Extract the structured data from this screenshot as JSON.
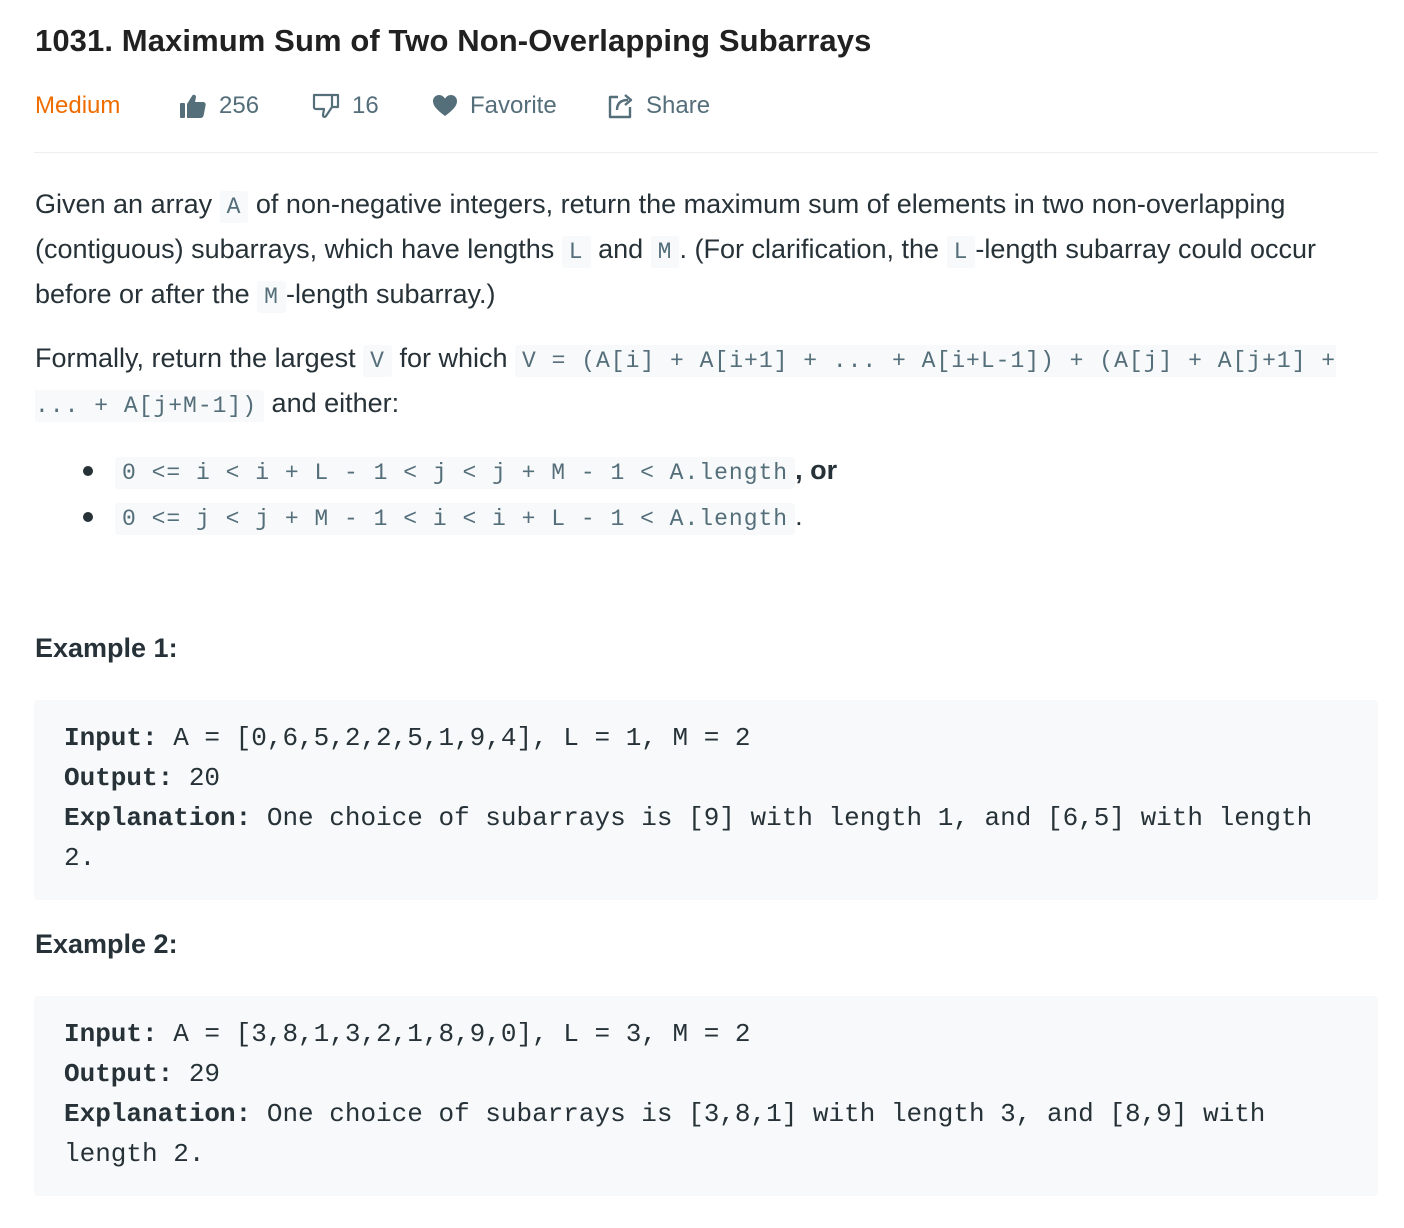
{
  "problem": {
    "title": "1031. Maximum Sum of Two Non-Overlapping Subarrays",
    "difficulty": "Medium",
    "likes": "256",
    "dislikes": "16",
    "favorite_label": "Favorite",
    "share_label": "Share"
  },
  "description": {
    "p1_a": "Given an array ",
    "code_A": "A",
    "p1_b": " of non-negative integers, return the maximum sum of elements in two non-overlapping (contiguous) subarrays, which have lengths ",
    "code_L": "L",
    "p1_c": " and ",
    "code_M": "M",
    "p1_d": ".  (For clarification, the ",
    "code_L2": "L",
    "p1_e": "-length subarray could occur before or after the ",
    "code_M2": "M",
    "p1_f": "-length subarray.)",
    "p2_a": "Formally, return the largest ",
    "code_V": "V",
    "p2_b": " for which ",
    "code_formula": "V = (A[i] + A[i+1] + ... + A[i+L-1]) + (A[j] + A[j+1] + ... + A[j+M-1])",
    "p2_c": " and either:",
    "bullet1_code": "0 <= i < i + L - 1 < j < j + M - 1 < A.length",
    "bullet1_suffix": ", or",
    "bullet2_code": "0 <= j < j + M - 1 < i < i + L - 1 < A.length",
    "bullet2_suffix": "."
  },
  "examples": [
    {
      "title": "Example 1:",
      "input_label": "Input:",
      "input": " A = [0,6,5,2,2,5,1,9,4], L = 1, M = 2",
      "output_label": "Output:",
      "output": " 20",
      "explanation_label": "Explanation:",
      "explanation": " One choice of subarrays is [9] with length 1, and [6,5] with length 2."
    },
    {
      "title": "Example 2:",
      "input_label": "Input:",
      "input": " A = [3,8,1,3,2,1,8,9,0], L = 3, M = 2",
      "output_label": "Output:",
      "output": " 29",
      "explanation_label": "Explanation:",
      "explanation": " One choice of subarrays is [3,8,1] with length 3, and [8,9] with length 2."
    }
  ],
  "colors": {
    "difficulty_medium": "#ef6c00",
    "text": "#263238",
    "muted": "#546e7a",
    "code_bg": "#f7f9fa"
  }
}
